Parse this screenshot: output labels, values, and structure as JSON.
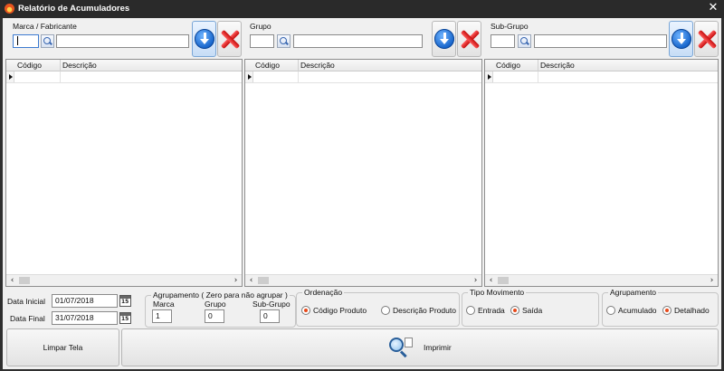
{
  "window": {
    "title": "Relatório de Acumuladores"
  },
  "marca": {
    "label": "Marca / Fabricante",
    "code_value": "",
    "desc_value": ""
  },
  "grupo": {
    "label": "Grupo",
    "code_value": "",
    "desc_value": ""
  },
  "subgrupo": {
    "label": "Sub-Grupo",
    "code_value": "",
    "desc_value": ""
  },
  "grids": {
    "columns": [
      "Código",
      "Descrição"
    ]
  },
  "dates": {
    "inicial_label": "Data Inicial",
    "inicial_value": "01/07/2018",
    "final_label": "Data Final",
    "final_value": "31/07/2018"
  },
  "agrupamento_zero": {
    "title": "Agrupamento ( Zero para não agrupar )",
    "marca_label": "Marca",
    "marca_value": "1",
    "grupo_label": "Grupo",
    "grupo_value": "0",
    "subgrupo_label": "Sub-Grupo",
    "subgrupo_value": "0"
  },
  "ordenacao": {
    "title": "Ordenação",
    "options": [
      "Código Produto",
      "Descrição Produto"
    ],
    "selected": "Código Produto"
  },
  "tipo_movimento": {
    "title": "Tipo Movimento",
    "options": [
      "Entrada",
      "Saída"
    ],
    "selected": "Saída"
  },
  "agrupamento": {
    "title": "Agrupamento",
    "options": [
      "Acumulado",
      "Detalhado"
    ],
    "selected": "Detalhado"
  },
  "footer": {
    "clear_label": "Limpar Tela",
    "print_label": "Imprimir"
  },
  "colors": {
    "radio_selected": "#e7491a",
    "confirm_blue": "#1462c9",
    "cancel_red": "#c40d0d"
  }
}
